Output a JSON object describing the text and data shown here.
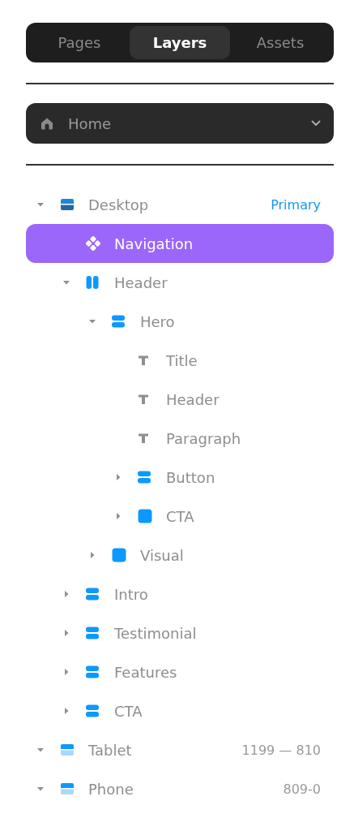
{
  "tabs": [
    {
      "label": "Pages",
      "selected": false
    },
    {
      "label": "Layers",
      "selected": true
    },
    {
      "label": "Assets",
      "selected": false
    }
  ],
  "page_select": {
    "value": "Home"
  },
  "layers": [
    {
      "name": "Desktop",
      "kind": "breakpoint",
      "primary": true,
      "tag": "Primary",
      "expanded": true,
      "selected": false,
      "children": [
        {
          "name": "Navigation",
          "kind": "component",
          "selected": true
        },
        {
          "name": "Header",
          "kind": "columns",
          "expanded": true,
          "selected": false,
          "children": [
            {
              "name": "Hero",
              "kind": "rows",
              "expanded": true,
              "selected": false,
              "children": [
                {
                  "name": "Title",
                  "kind": "text",
                  "selected": false
                },
                {
                  "name": "Header",
                  "kind": "text",
                  "selected": false
                },
                {
                  "name": "Paragraph",
                  "kind": "text",
                  "selected": false
                },
                {
                  "name": "Button",
                  "kind": "rows",
                  "expanded": false,
                  "selected": false
                },
                {
                  "name": "CTA",
                  "kind": "box",
                  "expanded": false,
                  "selected": false
                }
              ]
            },
            {
              "name": "Visual",
              "kind": "box",
              "expanded": false,
              "selected": false
            }
          ]
        },
        {
          "name": "Intro",
          "kind": "rows",
          "expanded": false,
          "selected": false
        },
        {
          "name": "Testimonial",
          "kind": "rows",
          "expanded": false,
          "selected": false
        },
        {
          "name": "Features",
          "kind": "rows",
          "expanded": false,
          "selected": false
        },
        {
          "name": "CTA",
          "kind": "rows",
          "expanded": false,
          "selected": false
        }
      ]
    },
    {
      "name": "Tablet",
      "kind": "breakpoint",
      "primary": false,
      "tag": "1199 — 810",
      "expanded": true,
      "selected": false
    },
    {
      "name": "Phone",
      "kind": "breakpoint",
      "primary": false,
      "tag": "809-0",
      "expanded": true,
      "selected": false
    }
  ]
}
